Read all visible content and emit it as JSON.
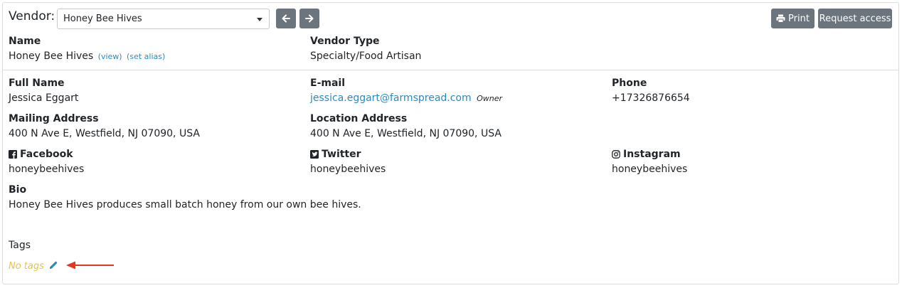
{
  "header": {
    "vendor_label": "Vendor:",
    "selected_vendor": "Honey Bee Hives",
    "print_label": "Print",
    "request_access_label": "Request access"
  },
  "summary": {
    "name_label": "Name",
    "name_value": "Honey Bee Hives",
    "view_link": "(view)",
    "set_alias_link": "(set alias)",
    "vendor_type_label": "Vendor Type",
    "vendor_type_value": "Specialty/Food Artisan"
  },
  "details": {
    "full_name_label": "Full Name",
    "full_name_value": "Jessica Eggart",
    "email_label": "E-mail",
    "email_value": "jessica.eggart@farmspread.com",
    "email_role": "Owner",
    "phone_label": "Phone",
    "phone_value": "+17326876654",
    "mailing_label": "Mailing Address",
    "mailing_value": "400 N Ave E, Westfield, NJ 07090, USA",
    "location_label": "Location Address",
    "location_value": "400 N Ave E, Westfield, NJ 07090, USA",
    "facebook_label": "Facebook",
    "facebook_value": "honeybeehives",
    "twitter_label": "Twitter",
    "twitter_value": "honeybeehives",
    "instagram_label": "Instagram",
    "instagram_value": "honeybeehives",
    "bio_label": "Bio",
    "bio_value": "Honey Bee Hives produces small batch honey from our own bee hives."
  },
  "tags": {
    "label": "Tags",
    "empty_text": "No tags"
  },
  "colors": {
    "button_gray": "#6c757d",
    "link_blue": "#2a8bc0",
    "tags_yellow": "#e8c24a",
    "arrow_red": "#e8341c"
  }
}
